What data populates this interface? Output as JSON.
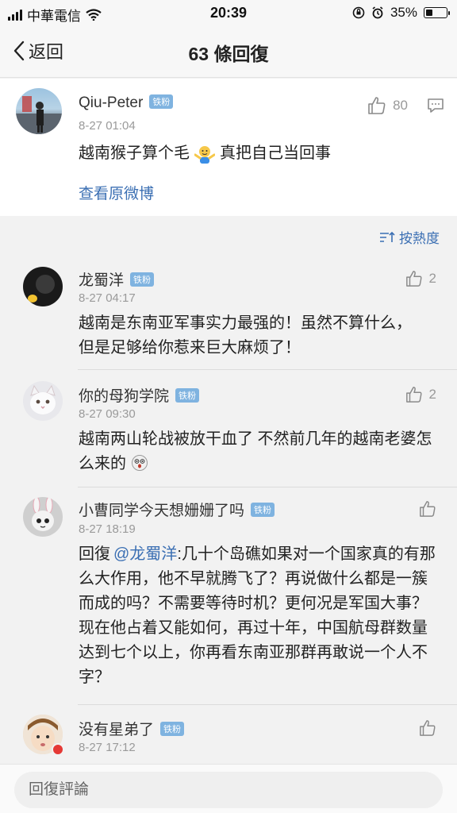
{
  "status_bar": {
    "carrier": "中華電信",
    "time": "20:39",
    "battery": "35%",
    "battery_level": 0.35
  },
  "nav": {
    "back_label": "返回",
    "title": "63 條回復"
  },
  "post": {
    "author": "Qiu-Peter",
    "badge": "铁粉",
    "time": "8-27 01:04",
    "content_before": "越南猴子算个毛",
    "content_after": "真把自己当回事",
    "like_count": "80",
    "view_original": "查看原微博"
  },
  "sort": {
    "label": "按熱度"
  },
  "comments": [
    {
      "name": "龙蜀洋",
      "badge": "铁粉",
      "time": "8-27 04:17",
      "likes": "2",
      "text": "越南是东南亚军事实力最强的！虽然不算什么，但是足够给你惹来巨大麻烦了！"
    },
    {
      "name": "你的母狗学院",
      "badge": "铁粉",
      "time": "8-27 09:30",
      "likes": "2",
      "text": "越南两山轮战被放干血了 不然前几年的越南老婆怎么来的"
    },
    {
      "name": "小曹同学今天想姗姗了吗",
      "badge": "铁粉",
      "time": "8-27 18:19",
      "likes": "",
      "reply_prefix": "回復",
      "mention": "@龙蜀洋",
      "text": ":几十个岛礁如果对一个国家真的有那么大作用，他不早就腾飞了？再说做什么都是一簇而成的吗？不需要等待时机？更何况是军国大事？现在他占着又能如何，再过十年，中国航母群数量达到七个以上，你再看东南亚那群再敢说一个人不字？"
    },
    {
      "name": "没有星弟了",
      "badge": "铁粉",
      "time": "8-27 17:12",
      "likes": ""
    }
  ],
  "bottom": {
    "placeholder": "回復評論"
  },
  "colors": {
    "link": "#3b6fb3",
    "badge": "#7fb3e0",
    "meta": "#9a9a9a"
  }
}
